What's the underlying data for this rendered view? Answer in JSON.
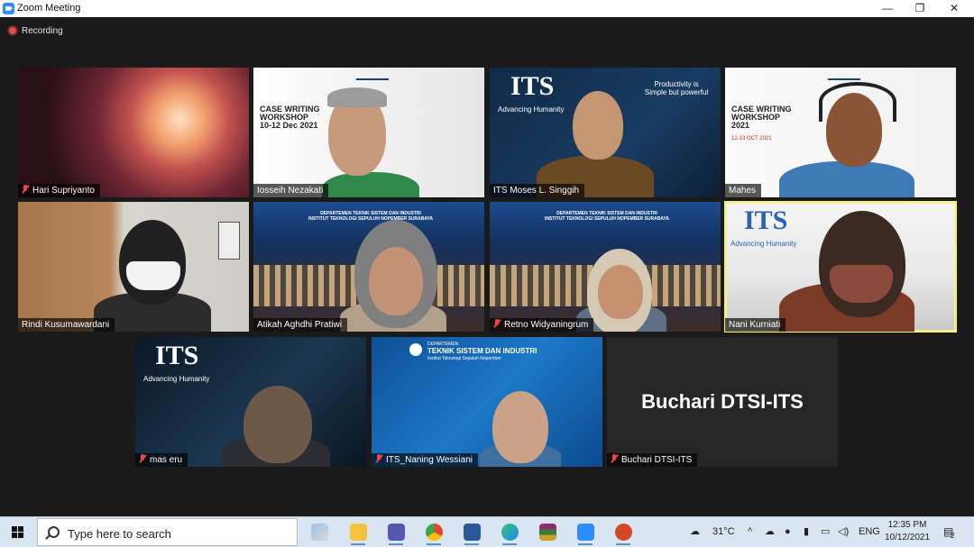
{
  "window": {
    "title": "Zoom Meeting",
    "minimize": "—",
    "maximize": "❐",
    "close": "✕"
  },
  "recording": {
    "label": "Recording"
  },
  "participants": [
    {
      "name": "Hari Supriyanto",
      "muted": true
    },
    {
      "name": "Iosseih Nezakati",
      "muted": false,
      "bg_title": "CASE WRITING\nWORKSHOP\n10-12 Dec 2021"
    },
    {
      "name": "ITS Moses L. Singgih",
      "muted": false,
      "bg_logo": "ITS",
      "bg_slogan": "Advancing Humanity",
      "bg_tagline": "Productivity is\nSimple but powerful"
    },
    {
      "name": "Mahes",
      "muted": false,
      "bg_title": "CASE WRITING\nWORKSHOP\n2021",
      "bg_date": "12-13 OCT 2021"
    },
    {
      "name": "Rindi Kusumawardani",
      "muted": false
    },
    {
      "name": "Atikah Aghdhi Pratiwi",
      "muted": false,
      "bg_header": "DEPARTEMEN TEKNIK SISTEM DAN INDUSTRI\nINSTITUT TEKNOLOGI SEPULUH NOPEMBER SURABAYA"
    },
    {
      "name": "Retno Widyaningrum",
      "muted": true,
      "bg_header": "DEPARTEMEN TEKNIK SISTEM DAN INDUSTRI\nINSTITUT TEKNOLOGI SEPULUH NOPEMBER SURABAYA"
    },
    {
      "name": "Nani Kurniati",
      "muted": false,
      "active": true,
      "bg_logo": "ITS",
      "bg_slogan": "Advancing Humanity"
    },
    {
      "name": "mas eru",
      "muted": true,
      "bg_logo": "ITS",
      "bg_slogan": "Advancing Humanity"
    },
    {
      "name": "ITS_Naning Wessiani",
      "muted": true,
      "bg_dept": "DEPARTEMEN",
      "bg_title": "TEKNIK SISTEM DAN INDUSTRI",
      "bg_sub": "Institut Teknologi Sepuluh Nopember"
    },
    {
      "name": "Buchari DTSI-ITS",
      "muted": true,
      "display_name": "Buchari DTSI-ITS"
    }
  ],
  "taskbar": {
    "search_placeholder": "Type here to search",
    "weather": "31°C",
    "language": "ENG",
    "time": "12:35 PM",
    "date": "10/12/2021",
    "notification_count": "2"
  }
}
